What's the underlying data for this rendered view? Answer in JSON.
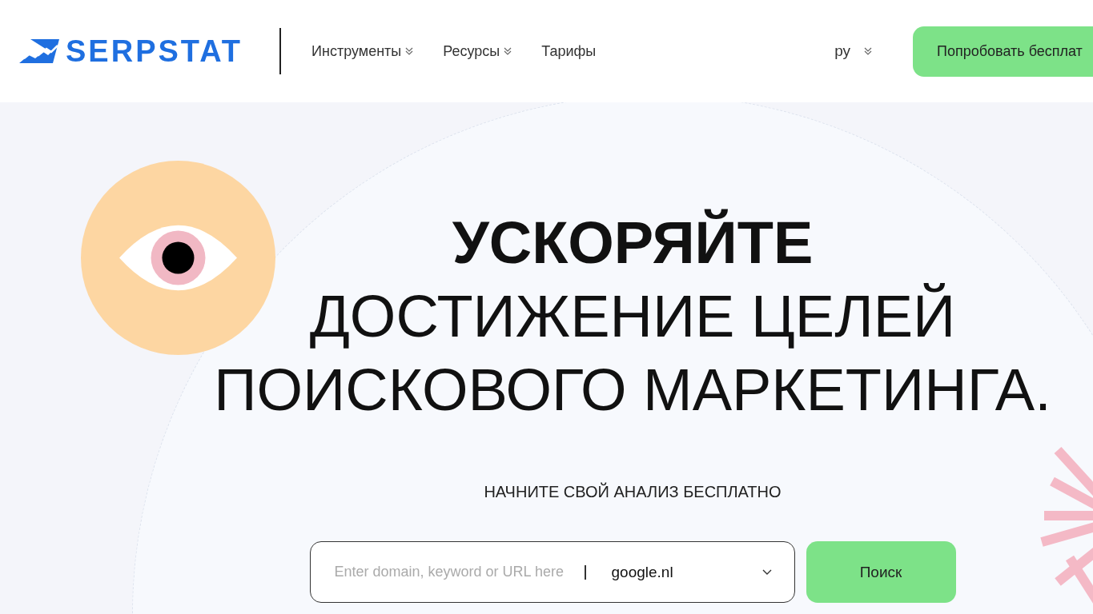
{
  "header": {
    "logo": "SERPSTAT",
    "nav": [
      {
        "label": "Инструменты",
        "dropdown": true
      },
      {
        "label": "Ресурсы",
        "dropdown": true
      },
      {
        "label": "Тарифы",
        "dropdown": false
      }
    ],
    "language": "ру",
    "cta_button": "Попробовать бесплат"
  },
  "hero": {
    "title_lines": [
      {
        "text": "УСКОРЯЙТЕ",
        "bold": true
      },
      {
        "text": "ДОСТИЖЕНИЕ ЦЕЛЕЙ",
        "bold": false
      },
      {
        "text": "ПОИСКОВОГО МАРКЕТИНГА.",
        "bold": false
      }
    ],
    "subtitle": "НАЧНИТЕ СВОЙ АНАЛИЗ БЕСПЛАТНО",
    "search": {
      "placeholder": "Enter domain, keyword or URL here",
      "engine": "google.nl",
      "button": "Поиск"
    }
  }
}
